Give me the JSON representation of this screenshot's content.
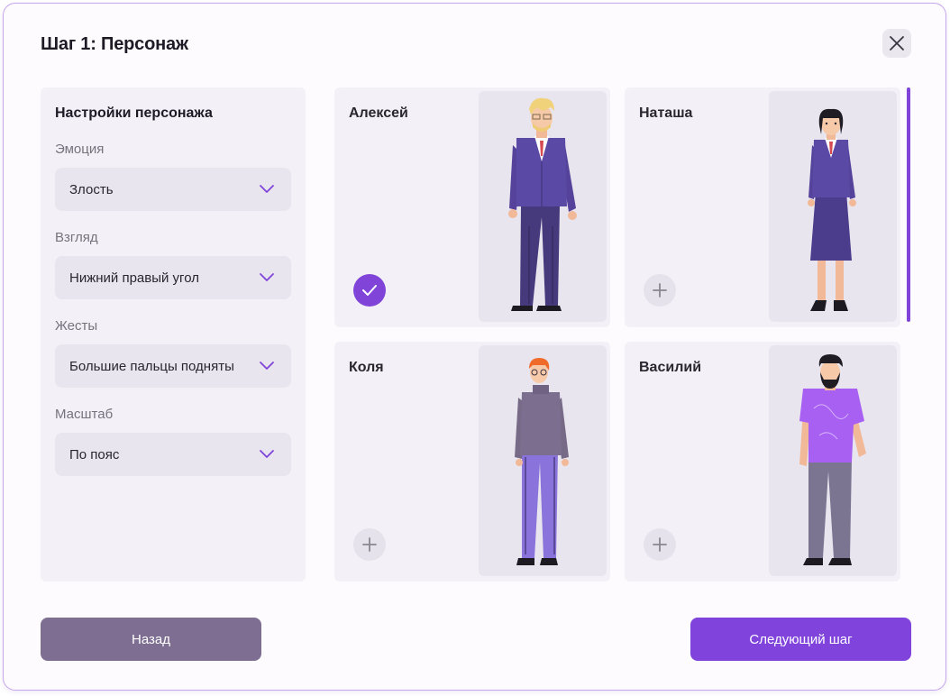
{
  "dialog": {
    "title": "Шаг 1: Персонаж"
  },
  "settings": {
    "title": "Настройки персонажа",
    "fields": [
      {
        "label": "Эмоция",
        "value": "Злость"
      },
      {
        "label": "Взгляд",
        "value": "Нижний правый угол"
      },
      {
        "label": "Жесты",
        "value": "Большие пальцы подняты"
      },
      {
        "label": "Масштаб",
        "value": "По пояс"
      }
    ]
  },
  "characters": [
    {
      "name": "Алексей",
      "selected": true
    },
    {
      "name": "Наташа",
      "selected": false
    },
    {
      "name": "Коля",
      "selected": false
    },
    {
      "name": "Василий",
      "selected": false
    }
  ],
  "colors": {
    "accent": "#8044d9",
    "back_button": "#7d6e92",
    "panel": "#f3f1f7"
  },
  "footer": {
    "back_label": "Назад",
    "next_label": "Следующий шаг"
  }
}
